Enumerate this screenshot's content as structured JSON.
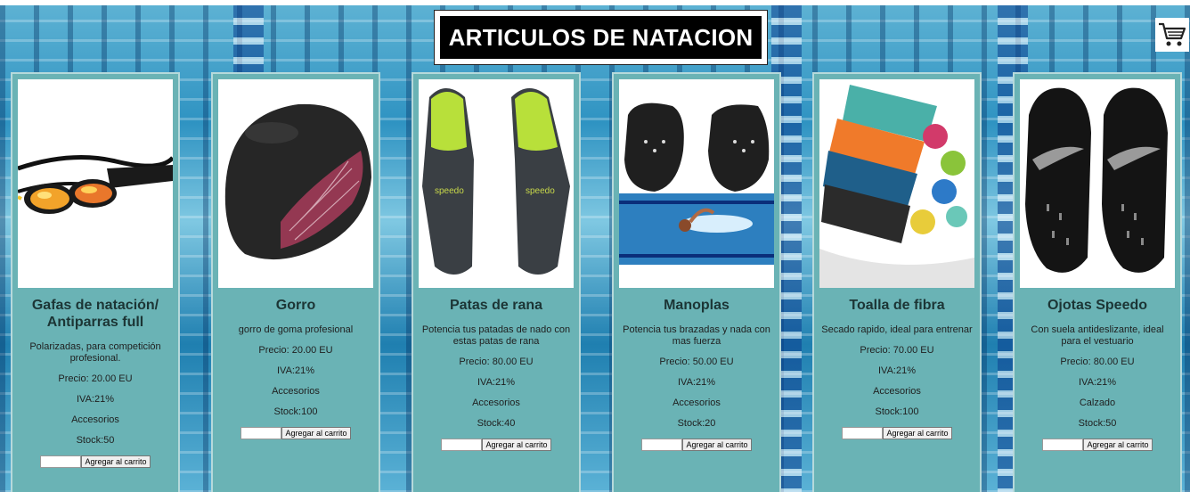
{
  "page": {
    "title": "ARTICULOS DE NATACION"
  },
  "cart": {
    "icon": "shopping-cart-icon"
  },
  "products": [
    {
      "name": "Gafas de natación/ Antiparras full",
      "description": "Polarizadas, para competición profesional.",
      "price": "Precio: 20.00 EU",
      "iva": "IVA:21%",
      "category": "Accesorios",
      "stock": "Stock:50",
      "quantity_value": "",
      "add_button": "Agregar al carrito",
      "image": "swim-goggles-image"
    },
    {
      "name": "Gorro",
      "description": "gorro de goma profesional",
      "price": "Precio: 20.00 EU",
      "iva": "IVA:21%",
      "category": "Accesorios",
      "stock": "Stock:100",
      "quantity_value": "",
      "add_button": "Agregar al carrito",
      "image": "swim-cap-image"
    },
    {
      "name": "Patas de rana",
      "description": "Potencia tus patadas de nado con estas patas de rana",
      "price": "Precio: 80.00 EU",
      "iva": "IVA:21%",
      "category": "Accesorios",
      "stock": "Stock:40",
      "quantity_value": "",
      "add_button": "Agregar al carrito",
      "image": "swim-fins-image"
    },
    {
      "name": "Manoplas",
      "description": "Potencia tus brazadas y nada con mas fuerza",
      "price": "Precio: 50.00 EU",
      "iva": "IVA:21%",
      "category": "Accesorios",
      "stock": "Stock:20",
      "quantity_value": "",
      "add_button": "Agregar al carrito",
      "image": "hand-paddles-image"
    },
    {
      "name": "Toalla de fibra",
      "description": "Secado rapido, ideal para entrenar",
      "price": "Precio: 70.00 EU",
      "iva": "IVA:21%",
      "category": "Accesorios",
      "stock": "Stock:100",
      "quantity_value": "",
      "add_button": "Agregar al carrito",
      "image": "microfiber-towels-image"
    },
    {
      "name": "Ojotas Speedo",
      "description": "Con suela antideslizante, ideal para el vestuario",
      "price": "Precio: 80.00 EU",
      "iva": "IVA:21%",
      "category": "Calzado",
      "stock": "Stock:50",
      "quantity_value": "",
      "add_button": "Agregar al carrito",
      "image": "speedo-slides-image"
    }
  ],
  "colors": {
    "card_bg": "#6ab3b5",
    "title_bg": "#000000",
    "pool_blue": "#2f93c2"
  }
}
